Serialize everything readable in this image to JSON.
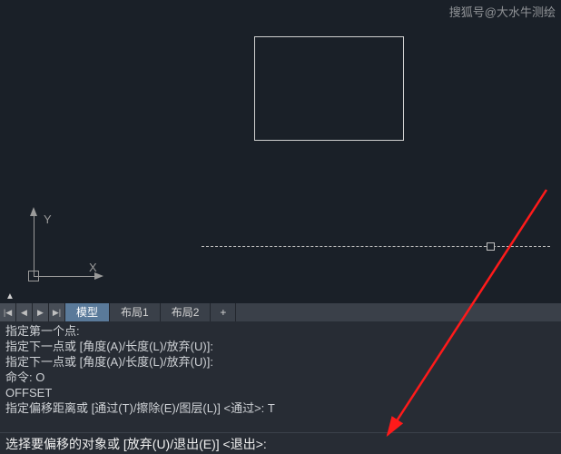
{
  "watermark": "搜狐号@大水牛测绘",
  "ucs": {
    "x_label": "X",
    "y_label": "Y"
  },
  "tabs": {
    "model": "模型",
    "layout1": "布局1",
    "layout2": "布局2",
    "add": "+"
  },
  "cmdlog": [
    "指定第一个点:",
    "指定下一点或 [角度(A)/长度(L)/放弃(U)]:",
    "指定下一点或 [角度(A)/长度(L)/放弃(U)]:",
    "命令: O",
    "OFFSET",
    "指定偏移距离或 [通过(T)/擦除(E)/图层(L)] <通过>: T",
    ""
  ],
  "cmdline": "选择要偏移的对象或 [放弃(U)/退出(E)] <退出>:"
}
